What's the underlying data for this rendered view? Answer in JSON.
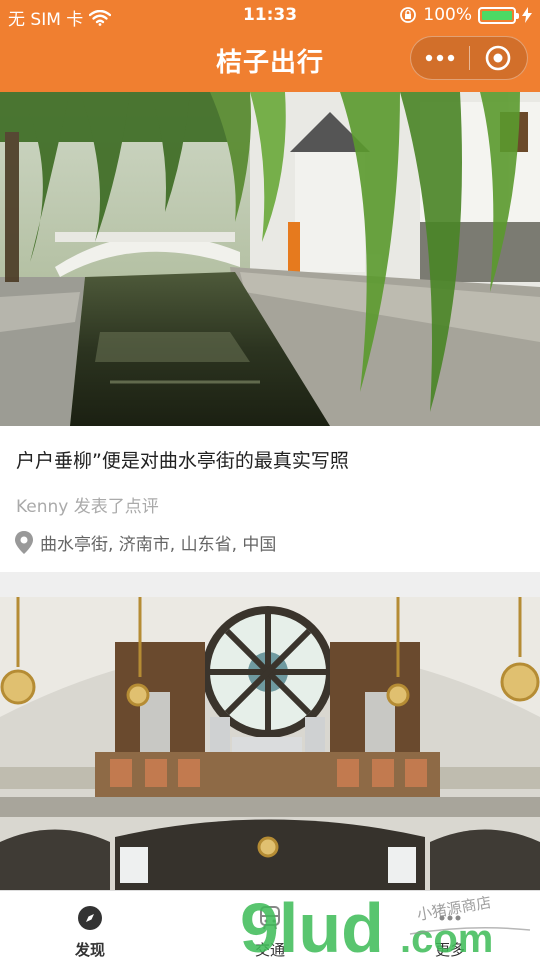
{
  "status_bar": {
    "carrier": "无 SIM 卡",
    "time": "11:33",
    "battery": "100%"
  },
  "nav": {
    "title": "桔子出行"
  },
  "feed": [
    {
      "caption": "户户垂柳”便是对曲水亭街的最真实写照",
      "author": "Kenny",
      "action": "发表了点评",
      "location": "曲水亭街, 济南市, 山东省, 中国"
    }
  ],
  "tabs": [
    {
      "label": "发现",
      "icon": "compass-icon"
    },
    {
      "label": "交通",
      "icon": "bus-icon"
    },
    {
      "label": "更多",
      "icon": "more-icon"
    }
  ],
  "watermark": {
    "brand": "9lud",
    "domain": ".com",
    "handwriting": "小猪源商店"
  },
  "colors": {
    "brand_orange": "#f07f30",
    "battery_green": "#4cd964",
    "watermark_green": "#3dbb57"
  }
}
